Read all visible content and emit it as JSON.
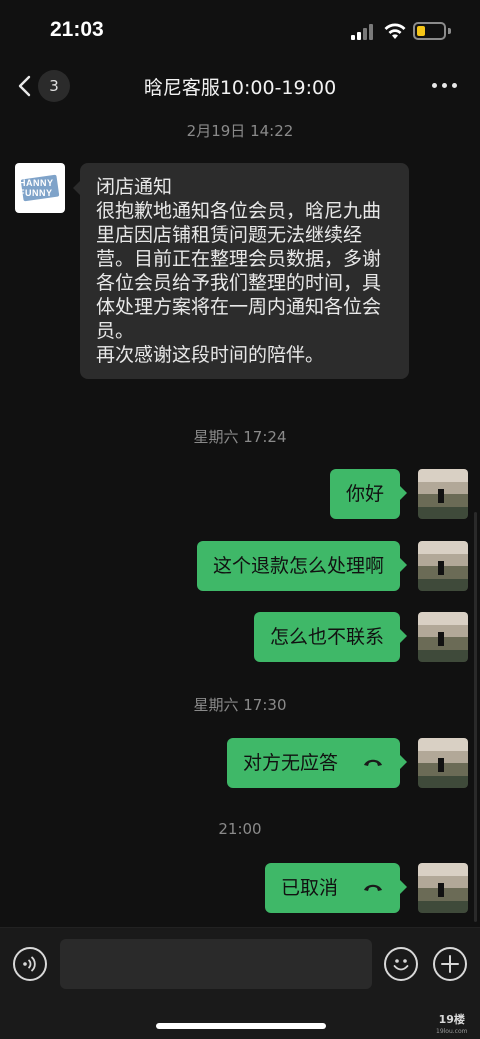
{
  "status_bar": {
    "time": "21:03",
    "battery_level": 0.3,
    "battery_color": "#f5c518"
  },
  "nav": {
    "back_icon": "chevron-left-icon",
    "unread_count": "3",
    "title": "晗尼客服10:00-19:00",
    "more_icon": "more-dots-icon"
  },
  "chat": {
    "messages": [
      {
        "type": "timestamp",
        "text": "2月19日 14:22"
      },
      {
        "type": "incoming",
        "sender_logo_text": [
          "HANNY",
          "FUNNY"
        ],
        "text": "闭店通知\n很抱歉地通知各位会员，晗尼九曲里店因店铺租赁问题无法继续经营。目前正在整理会员数据，多谢各位会员给予我们整理的时间，具体处理方案将在一周内通知各位会员。\n再次感谢这段时间的陪伴。"
      },
      {
        "type": "timestamp",
        "text": "星期六 17:24"
      },
      {
        "type": "outgoing",
        "text": "你好"
      },
      {
        "type": "outgoing",
        "text": "这个退款怎么处理啊"
      },
      {
        "type": "outgoing",
        "text": "怎么也不联系"
      },
      {
        "type": "timestamp",
        "text": "星期六 17:30"
      },
      {
        "type": "outgoing_call",
        "text": "对方无应答",
        "icon": "call-icon"
      },
      {
        "type": "timestamp",
        "text": "21:00"
      },
      {
        "type": "outgoing_call",
        "text": "已取消",
        "icon": "call-icon"
      }
    ],
    "outgoing_bubble_color": "#3fb868",
    "incoming_bubble_color": "#2c2c2c"
  },
  "input_bar": {
    "voice_icon": "voice-icon",
    "input_value": "",
    "emoji_icon": "emoji-icon",
    "plus_icon": "plus-icon"
  },
  "watermark": {
    "text": "19楼",
    "subtext": "19lou.com"
  }
}
